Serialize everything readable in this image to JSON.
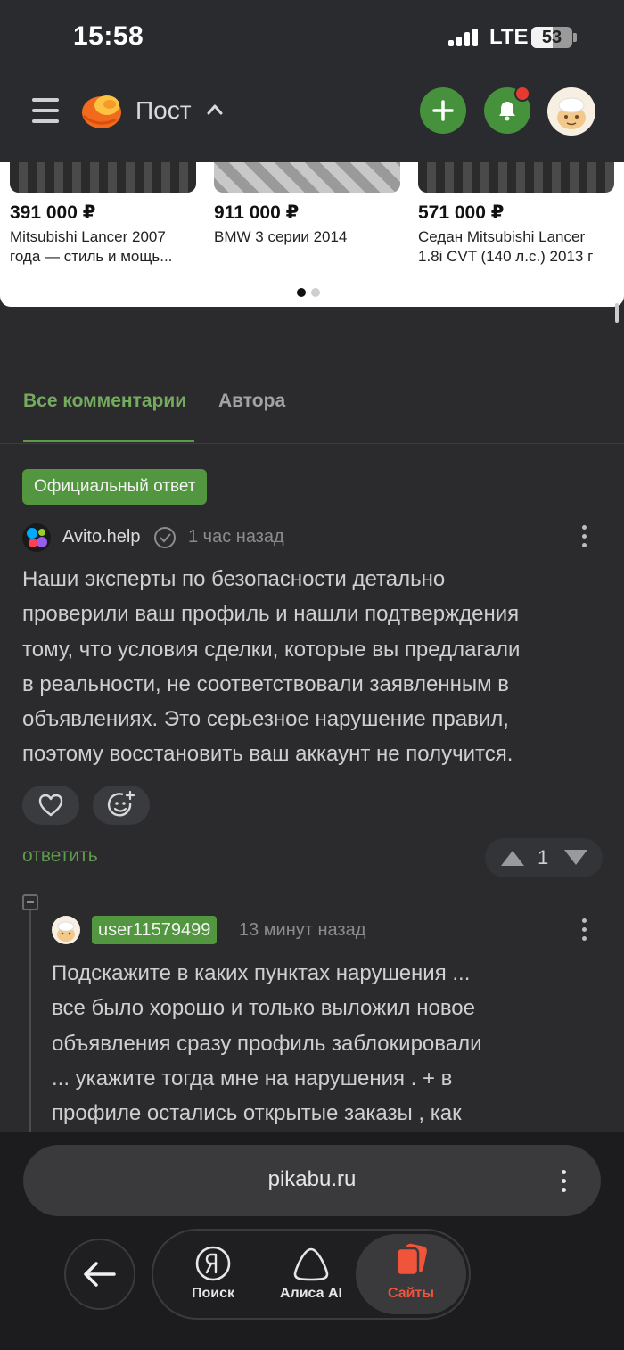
{
  "status_bar": {
    "time": "15:58",
    "network": "LTE",
    "battery": "53",
    "battery_level_pct": 53
  },
  "header": {
    "title": "Пост",
    "notification_dot_color": "#e43a2f",
    "accent": "#46913b"
  },
  "ads": {
    "items": [
      {
        "price": "391 000 ₽",
        "desc_line1": "Mitsubishi Lancer 2007",
        "desc_line2": "года — стиль и мощь..."
      },
      {
        "price": "911 000 ₽",
        "desc_line1": "BMW 3 серии 2014",
        "desc_line2": ""
      },
      {
        "price": "571 000 ₽",
        "desc_line1": "Седан Mitsubishi Lancer",
        "desc_line2": "1.8i CVT (140 л.с.) 2013 г"
      }
    ],
    "active_page": 1,
    "pages": 2
  },
  "tabs": [
    {
      "label": "Все комментарии",
      "active": true
    },
    {
      "label": "Автора",
      "active": false
    }
  ],
  "comment": {
    "badge": "Официальный ответ",
    "author": "Avito.help",
    "time": "1 час назад",
    "lines": [
      "Наши эксперты по безопасности детально",
      "проверили ваш профиль и нашли подтверждения",
      "тому, что условия сделки, которые вы предлагали",
      "в реальности, не соответствовали заявленным в",
      "объявлениях. Это серьезное нарушение правил,",
      "поэтому восстановить ваш аккаунт не получится."
    ],
    "reply_label": "ответить",
    "votes": "1"
  },
  "reply": {
    "author": "user11579499",
    "time": "13 минут назад",
    "lines": [
      "Подскажите в каких пунктах нарушения ...",
      "все было хорошо и только выложил новое",
      "объявления сразу профиль заблокировали",
      "... укажите тогда мне на нарушения . + в",
      "профиле остались открытые заказы , как"
    ]
  },
  "browser": {
    "url": "pikabu.ru",
    "nav": [
      {
        "label": "Поиск",
        "icon": "yandex-search-icon"
      },
      {
        "label": "Алиса AI",
        "icon": "alice-icon"
      },
      {
        "label": "Сайты",
        "icon": "sites-icon",
        "active": true,
        "color": "#f0553b"
      }
    ]
  }
}
